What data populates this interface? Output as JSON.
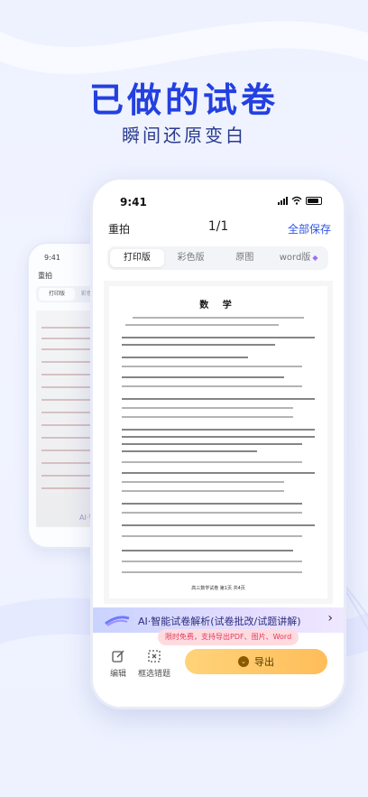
{
  "hero": {
    "title": "已做的试卷",
    "subtitle": "瞬间还原变白"
  },
  "back_phone": {
    "time": "9:41",
    "title": "重拍",
    "tab_active": "打印版",
    "tab_next": "彩色",
    "ai_label": "AI·智能试卷"
  },
  "status": {
    "time": "9:41"
  },
  "nav": {
    "retake": "重拍",
    "page_counter": "1/1",
    "save_all": "全部保存"
  },
  "tabs": [
    {
      "label": "打印版",
      "active": true
    },
    {
      "label": "彩色版",
      "active": false
    },
    {
      "label": "原图",
      "active": false
    },
    {
      "label": "word版",
      "active": false
    }
  ],
  "document": {
    "title": "数 学",
    "footer": "高三数学试卷 第1页 共4页"
  },
  "ai_banner": {
    "label": "AI·智能试卷解析(试卷批改/试题讲解)"
  },
  "toolbar": {
    "edit_label": "编辑",
    "select_wrong_label": "框选错题",
    "promo_text": "限时免费，支持导出PDF、图片、Word",
    "export_label": "导出"
  },
  "colors": {
    "accent": "#2f55e6",
    "hero_title": "#2340e0",
    "export_start": "#ffd37a",
    "export_end": "#ffbd5a",
    "promo_bg": "#ffdbe0",
    "promo_text": "#e03b5c"
  }
}
